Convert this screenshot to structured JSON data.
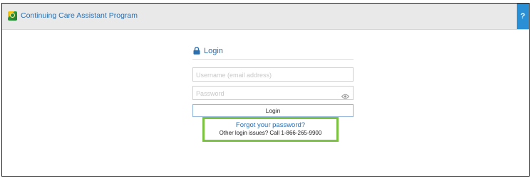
{
  "app": {
    "title": "Continuing Care Assistant Program",
    "help_label": "?"
  },
  "login": {
    "heading": "Login",
    "username_placeholder": "Username (email address)",
    "username_value": "",
    "password_placeholder": "Password",
    "password_value": "",
    "button_label": "Login",
    "forgot_link": "Forgot your password?",
    "other_issues": "Other login issues? Call 1-866-265-9900"
  },
  "icons": {
    "app_logo": "app-logo-icon",
    "lock": "lock-icon",
    "eye": "eye-icon"
  },
  "colors": {
    "accent_blue": "#2a6fb0",
    "help_button": "#2b8fd6",
    "highlight_green": "#7cc242",
    "topbar": "#e9e9e9"
  }
}
